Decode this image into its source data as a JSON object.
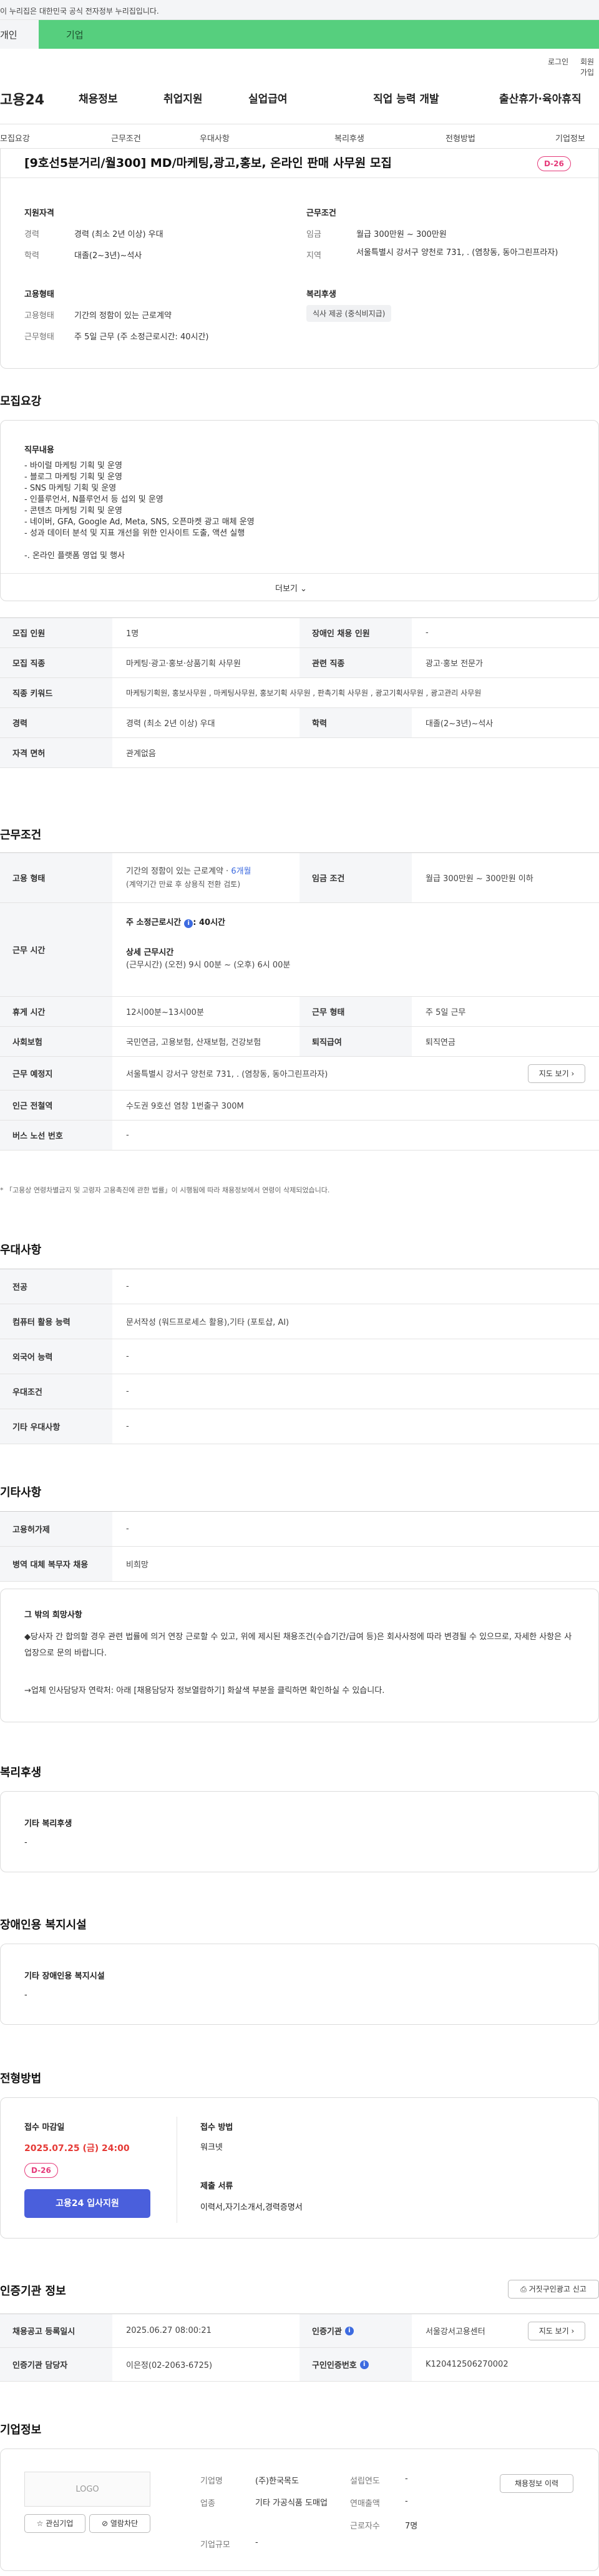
{
  "gov_banner": "이 누리집은 대한민국 공식 전자정부 누리집입니다.",
  "top_tabs": [
    "개인",
    "기업"
  ],
  "util_links": [
    "로그인",
    "회원가입"
  ],
  "logo": "고용24",
  "gnb": [
    "채용정보",
    "취업지원",
    "실업급여",
    "직업 능력 개발",
    "출산휴가·육아휴직"
  ],
  "subnav": [
    "모집요강",
    "근무조건",
    "우대사항",
    "복리후생",
    "전형방법",
    "기업정보"
  ],
  "job": {
    "title": "[9호선5분거리/월300] MD/마케팅,광고,홍보, 온라인 판매 사무원 모집",
    "dday": "D-26",
    "qual_head": "지원자격",
    "career_lbl": "경력",
    "career_val": "경력 (최소 2년 이상) 우대",
    "edu_lbl": "학력",
    "edu_val": "대졸(2~3년)~석사",
    "cond_head": "근무조건",
    "wage_lbl": "임금",
    "wage_val": "월급 300만원 ~ 300만원",
    "loc_lbl": "지역",
    "loc_val": "서울특별시 강서구 양천로 731, . (염창동, 동아그린프라자)",
    "emp_head": "고용형태",
    "emptype_lbl": "고용형태",
    "emptype_val": "기간의 정함이 있는 근로계약",
    "worktype_lbl": "근무형태",
    "worktype_val": "주 5일 근무 (주 소정근로시간: 40시간)",
    "welfare_head": "복리후생",
    "welfare_tag": "식사 제공 (중식비지급)"
  },
  "recruit": {
    "heading": "모집요강",
    "duty_head": "직무내용",
    "duty_lines": [
      "- 바이럴 마케팅 기획 및 운영",
      "- 블로그 마케팅 기획 및 운영",
      "- SNS 마케팅 기획 및 운영",
      "- 인플루언서, N플루언서 등 섭외 및 운영",
      "- 콘텐츠 마케팅 기획 및 운영",
      "- 네이버, GFA, Google Ad, Meta, SNS, 오픈마켓 광고 매체 운영",
      "- 성과 데이터 분석 및 지표 개선을 위한 인사이트 도출, 액션 실행",
      "",
      "-. 온라인 플랫폼 영업 및 행사"
    ],
    "more": "더보기"
  },
  "recruit_table": [
    [
      "모집 인원",
      "1명",
      "장애인 채용 인원",
      "-"
    ],
    [
      "모집 직종",
      "마케팅·광고·홍보·상품기획 사무원",
      "관련 직종",
      "광고·홍보 전문가"
    ],
    [
      "직종 키워드",
      "마케팅기획원, 홍보사무원 , 마케팅사무원, 홍보기획 사무원 , 판촉기획 사무원 , 광고기획사무원 , 광고관리 사무원"
    ],
    [
      "경력",
      "경력 (최소 2년 이상) 우대",
      "학력",
      "대졸(2~3년)~석사"
    ],
    [
      "자격 면허",
      "관계없음"
    ]
  ],
  "conditions": {
    "heading": "근무조건",
    "emp_lbl": "고용 형태",
    "emp_val": "기간의 정함이 있는 근로계약 · ",
    "emp_months": "6개월",
    "emp_note": "(계약기간 만료 후 상용직 전환 검토)",
    "wage_lbl": "임금 조건",
    "wage_val": "월급 300만원 ~ 300만원 이하",
    "hours_lbl": "근무 시간",
    "hours_week": "주 소정근로시간",
    "hours_week_val": ": 40시간",
    "hours_detail_head": "상세 근무시간",
    "hours_detail": "(근무시간) (오전) 9시 00분 ~ (오후) 6시 00분",
    "rest_lbl": "휴게 시간",
    "rest_val": "12시00분~13시00분",
    "form_lbl": "근무 형태",
    "form_val": "주 5일 근무",
    "ins_lbl": "사회보험",
    "ins_val": "국민연금, 고용보험, 산재보험, 건강보험",
    "retire_lbl": "퇴직급여",
    "retire_val": "퇴직연금",
    "place_lbl": "근무 예정지",
    "place_val": "서울특별시 강서구 양천로 731, . (염창동, 동아그린프라자)",
    "map_btn": "지도 보기",
    "subway_lbl": "인근 전철역",
    "subway_val": "수도권 9호선 염창 1번출구 300M",
    "bus_lbl": "버스 노선 번호",
    "bus_val": "-",
    "footnote": "* 「고용상 연령차별금지 및 고령자 고용촉진에 관한 법률」이 시행됨에 따라 채용정보에서 연령이 삭제되었습니다."
  },
  "prefer": {
    "heading": "우대사항",
    "rows": [
      [
        "전공",
        "-"
      ],
      [
        "컴퓨터 활용 능력",
        "문서작성 (워드프로세스 활용),기타 (포토샵, AI)"
      ],
      [
        "외국어 능력",
        "-"
      ],
      [
        "우대조건",
        "-"
      ],
      [
        "기타 우대사항",
        "-"
      ]
    ]
  },
  "etc": {
    "heading": "기타사항",
    "rows": [
      [
        "고용허가제",
        "-"
      ],
      [
        "병역 대체 복무자 채용",
        "비희망"
      ]
    ],
    "box_head": "그 밖의 희망사항",
    "box_line1": "◆당사자 간 합의할 경우 관련 법률에 의거 연장 근로할 수 있고, 위에 제시된 채용조건(수습기간/급여 등)은 회사사정에 따라 변경될 수 있으므로, 자세한 사항은 사업장으로 문의 바랍니다.",
    "box_line2": "→업체 인사담당자 연락처: 아래 [채용담당자 정보열람하기] 화살색 부분을 클릭하면 확인하실 수 있습니다."
  },
  "welfare": {
    "heading": "복리후생",
    "box_head": "기타 복리후생",
    "box_val": "-"
  },
  "disability": {
    "heading": "장애인용 복지시설",
    "box_head": "기타 장애인용 복지시설",
    "box_val": "-"
  },
  "selection": {
    "heading": "전형방법",
    "deadline_lbl": "접수 마감일",
    "deadline_val": "2025.07.25 (금) 24:00",
    "dday": "D-26",
    "apply_btn": "고용24 입사지원",
    "method_lbl": "접수 방법",
    "method_val": "워크넷",
    "docs_lbl": "제출 서류",
    "docs_val": "이력서,자기소개서,경력증명서"
  },
  "cert": {
    "heading": "인증기관 정보",
    "report_btn": "거짓구인광고 신고",
    "reg_lbl": "채용공고 등록일시",
    "reg_val": "2025.06.27 08:00:21",
    "org_lbl": "인증기관",
    "org_val": "서울강서고용센터",
    "map_btn": "지도 보기",
    "mgr_lbl": "인증기관 담당자",
    "mgr_val": "이은정(02-2063-6725)",
    "no_lbl": "구인인증번호",
    "no_val": "K120412506270002"
  },
  "company": {
    "heading": "기업정보",
    "logo": "LOGO",
    "fav_btn": "관심기업",
    "block_btn": "열람차단",
    "name_lbl": "기업명",
    "name_val": "(주)한국목도",
    "biz_lbl": "업종",
    "biz_val": "기타 가공식품 도매업",
    "size_lbl": "기업규모",
    "size_val": "-",
    "year_lbl": "설립연도",
    "year_val": "-",
    "sales_lbl": "연매출액",
    "sales_val": "-",
    "emp_lbl": "근로자수",
    "emp_val": "7명",
    "history_btn": "채용정보 이력"
  }
}
